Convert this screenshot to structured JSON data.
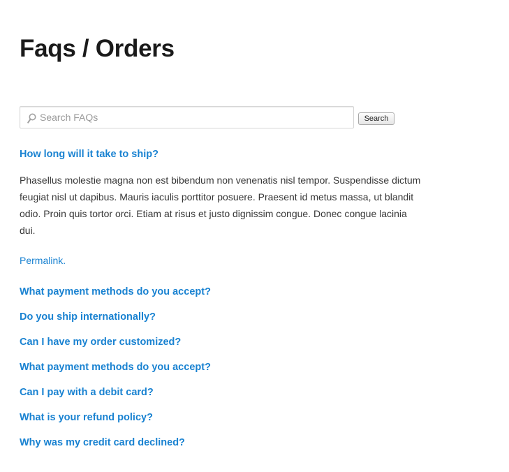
{
  "page": {
    "title": "Faqs / Orders"
  },
  "search": {
    "placeholder": "Search FAQs",
    "value": "",
    "button_label": "Search"
  },
  "faqs": [
    {
      "question": "How long will it take to ship?",
      "answer": "Phasellus molestie magna non est bibendum non venenatis nisl tempor. Suspendisse dictum feugiat nisl ut dapibus. Mauris iaculis porttitor posuere. Praesent id metus massa, ut blandit odio. Proin quis tortor orci. Etiam at risus et justo dignissim congue. Donec congue lacinia dui.",
      "permalink_label": "Permalink."
    },
    {
      "question": "What payment methods do you accept?"
    },
    {
      "question": "Do you ship internationally?"
    },
    {
      "question": "Can I have my order customized?"
    },
    {
      "question": "What payment methods do you accept?"
    },
    {
      "question": "Can I pay with a debit card?"
    },
    {
      "question": "What is your refund policy?"
    },
    {
      "question": "Why was my credit card declined?"
    }
  ],
  "colors": {
    "link": "#1982d1",
    "title": "#1a1a1a",
    "body_text": "#373737"
  },
  "icons": {
    "search": "search-icon"
  }
}
